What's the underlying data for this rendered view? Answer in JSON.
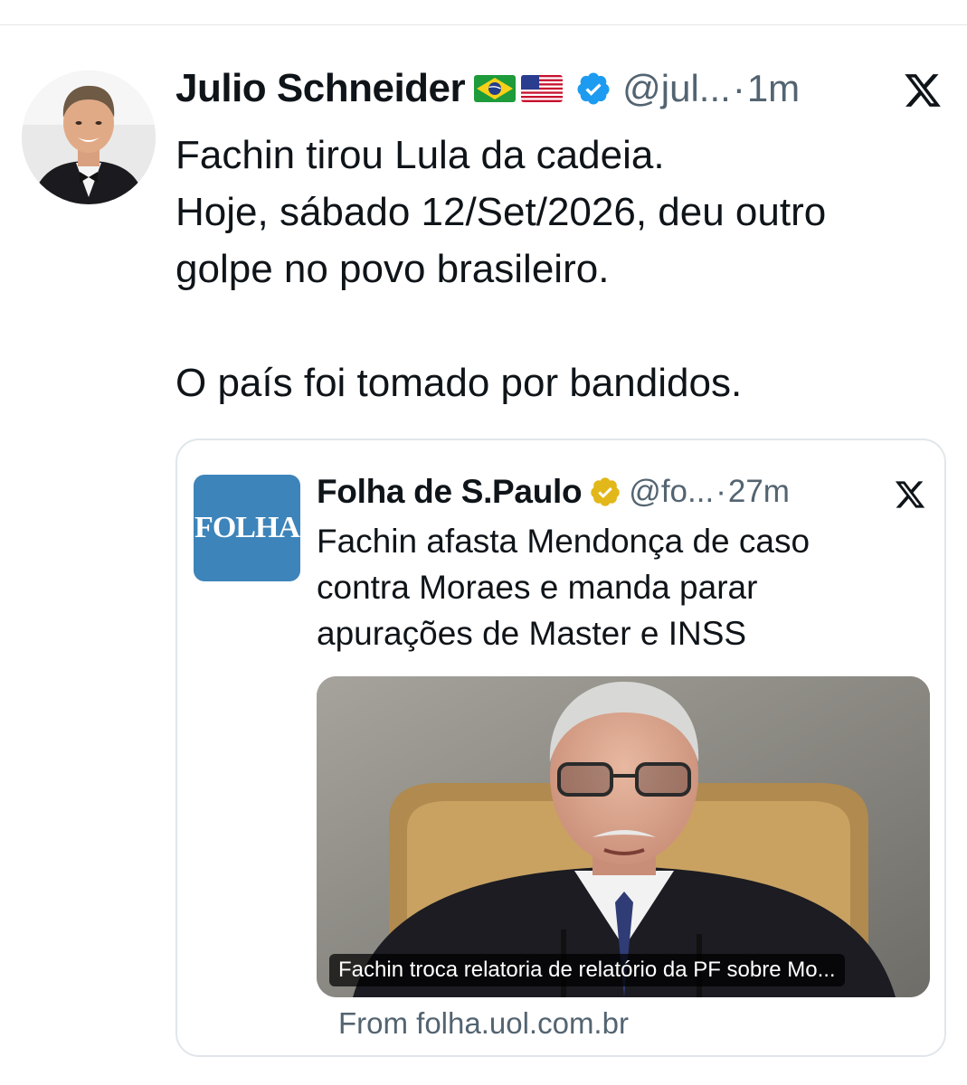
{
  "tweet": {
    "author_name": "Julio Schneider",
    "flags": [
      "brazil-flag",
      "usa-flag"
    ],
    "verified_badge": "blue-verified-icon",
    "handle": "@jul...",
    "separator": "·",
    "time": "1m",
    "platform_icon": "x-logo-icon",
    "text_lines": [
      "Fachin tirou Lula da cadeia.",
      "Hoje, sábado 12/Set/2026, deu outro",
      "golpe no povo brasileiro.",
      "O país foi tomado por bandidos."
    ]
  },
  "quoted": {
    "avatar_text": "FOLHA",
    "author_name": "Folha de S.Paulo",
    "verified_badge": "gold-verified-icon",
    "handle": "@fo...",
    "separator": "·",
    "time": "27m",
    "platform_icon": "x-logo-icon",
    "text_lines": [
      "Fachin afasta Mendonça de caso",
      "contra Moraes e manda parar",
      "apurações de Master e INSS"
    ],
    "media_caption": "Fachin troca relatoria de relatório da PF sobre Mo...",
    "source_text": "From folha.uol.com.br"
  },
  "colors": {
    "text_primary": "#0f1419",
    "text_secondary": "#536471",
    "verified_blue": "#1d9bf0",
    "verified_gold": "#e2b719",
    "folha_blue": "#3d84ba",
    "card_border": "#e1e6ea"
  }
}
